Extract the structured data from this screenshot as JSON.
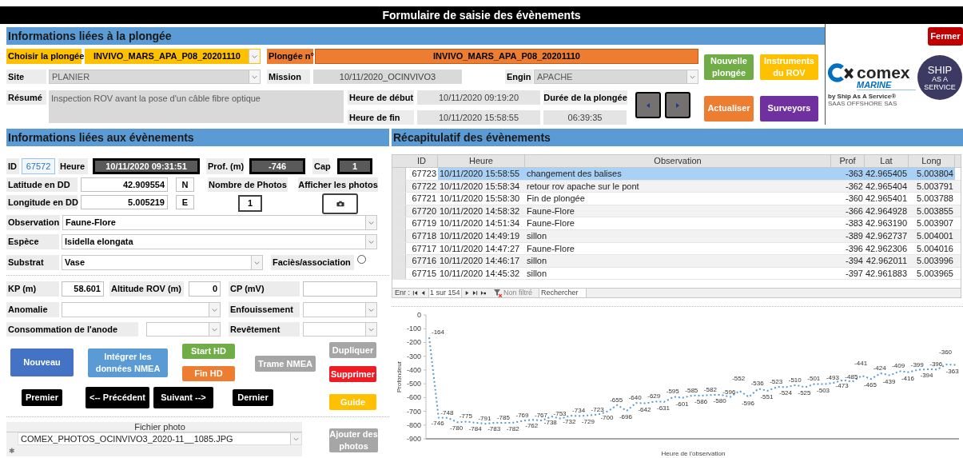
{
  "window": {
    "title": "Formulaire de saisie des évènements"
  },
  "close_button": {
    "label": "Fermer",
    "color": "#c00000"
  },
  "dive_section": {
    "heading": "Informations liées à la plongée",
    "choose_dive": {
      "label": "Choisir la plongée",
      "value": "INVIVO_MARS_APA_P08_20201110"
    },
    "dive_number": {
      "label": "Plongée n°",
      "value": "INVIVO_MARS_APA_P08_20201110"
    },
    "site": {
      "label": "Site",
      "value": "PLANIER"
    },
    "mission": {
      "label": "Mission",
      "value": "10/11/2020_OCINVIVO3"
    },
    "vehicle": {
      "label": "Engin",
      "value": "APACHE"
    },
    "summary": {
      "label": "Résumé",
      "value": "Inspection ROV avant la pose d'un câble fibre optique"
    },
    "start_time": {
      "label": "Heure de début",
      "value": "10/11/2020 09:19:20"
    },
    "end_time": {
      "label": "Heure de fin",
      "value": "10/11/2020 15:58:55"
    },
    "duration": {
      "label": "Durée de la plongée",
      "value": "06:39:35"
    },
    "buttons": [
      {
        "label": "Nouvelle plongée",
        "color": "#70ad47"
      },
      {
        "label": "Instruments du ROV",
        "color": "#ffc000"
      },
      {
        "label": "Actualiser",
        "color": "#ed7d31"
      },
      {
        "label": "Surveyors",
        "color": "#7030a0"
      }
    ]
  },
  "logo": {
    "brand": "comex",
    "division": "MARINE",
    "byline": "by Ship As A Service®",
    "company": "SAAS OFFSHORE SAS",
    "badge_lines": [
      "SHIP",
      "AS A",
      "SERVICE"
    ]
  },
  "event_section": {
    "heading": "Informations liées aux évènements",
    "id": {
      "label": "ID",
      "value": "67572"
    },
    "time": {
      "label": "Heure",
      "value": "10/11/2020 09:31:51"
    },
    "depth": {
      "label": "Prof. (m)",
      "value": "-746"
    },
    "bearing": {
      "label": "Cap",
      "value": "1"
    },
    "latitude": {
      "label": "Latitude en DD",
      "value": "42.909554",
      "hemisphere": "N"
    },
    "longitude": {
      "label": "Longitude en DD",
      "value": "5.005219",
      "hemisphere": "E"
    },
    "photo_count": {
      "label": "Nombre de Photos",
      "value": "1"
    },
    "show_photos": {
      "label": "Afficher les photos"
    },
    "observation": {
      "label": "Observation",
      "value": "Faune-Flore"
    },
    "species": {
      "label": "Espèce",
      "value": "Isidella elongata"
    },
    "substrate": {
      "label": "Substrat",
      "value": "Vase"
    },
    "facies": {
      "label": "Faciès/association",
      "checked": false
    },
    "kp": {
      "label": "KP (m)",
      "value": "58.601"
    },
    "rov_altitude": {
      "label": "Altitude ROV (m)",
      "value": "0"
    },
    "cp": {
      "label": "CP (mV)"
    },
    "anomaly": {
      "label": "Anomalie"
    },
    "burial": {
      "label": "Enfouissement"
    },
    "anode": {
      "label": "Consommation de l'anode"
    },
    "coating": {
      "label": "Revêtement"
    },
    "buttons": [
      {
        "label": "Nouveau",
        "color": "#4472c4"
      },
      {
        "label": "Intégrer les données NMEA",
        "color": "#5b9bd5"
      },
      {
        "label": "Start HD",
        "color": "#70ad47"
      },
      {
        "label": "Fin HD",
        "color": "#ed7d31"
      },
      {
        "label": "Trame NMEA",
        "color": "#a6a6a6"
      },
      {
        "label": "Dupliquer",
        "color": "#a6a6a6"
      },
      {
        "label": "Supprimer",
        "color": "#ee1c25"
      },
      {
        "label": "Premier",
        "color": "#000000"
      },
      {
        "label": "<-- Précédent",
        "color": "#000000"
      },
      {
        "label": "Suivant -->",
        "color": "#000000"
      },
      {
        "label": "Dernier",
        "color": "#000000"
      },
      {
        "label": "Guide",
        "color": "#ffc000"
      }
    ],
    "photos": {
      "column": "Fichier photo",
      "rows": [
        "COMEX_PHOTOS_OCINVIVO3_2020-11__1085.JPG"
      ],
      "new_record_marker": "✱",
      "add_button": "Ajouter des photos"
    }
  },
  "events_summary": {
    "heading": "Récapitulatif des évènements",
    "table": {
      "columns": [
        "ID",
        "Heure",
        "Observation",
        "Prof",
        "Lat",
        "Long"
      ],
      "rows": [
        {
          "cells": [
            "67723",
            "10/11/2020 15:58:55",
            "changement des balises",
            "-363",
            "42.965405",
            "5.003804"
          ],
          "selected": true
        },
        {
          "cells": [
            "67722",
            "10/11/2020 15:58:34",
            "retour rov apache sur le pont",
            "-362",
            "42.965404",
            "5.003791"
          ],
          "selected": false
        },
        {
          "cells": [
            "67721",
            "10/11/2020 15:58:30",
            "Fin de plongée",
            "-360",
            "42.965401",
            "5.003788"
          ],
          "selected": false
        },
        {
          "cells": [
            "67720",
            "10/11/2020 14:58:32",
            "Faune-Flore",
            "-366",
            "42.964928",
            "5.003855"
          ],
          "selected": false
        },
        {
          "cells": [
            "67719",
            "10/11/2020 14:51:34",
            "Faune-Flore",
            "-383",
            "42.963190",
            "5.003907"
          ],
          "selected": false
        },
        {
          "cells": [
            "67718",
            "10/11/2020 14:49:19",
            "sillon",
            "-389",
            "42.962737",
            "5.004001"
          ],
          "selected": false
        },
        {
          "cells": [
            "67717",
            "10/11/2020 14:47:27",
            "Faune-Flore",
            "-396",
            "42.962306",
            "5.004016"
          ],
          "selected": false
        },
        {
          "cells": [
            "67716",
            "10/11/2020 14:46:17",
            "sillon",
            "-394",
            "42.962011",
            "5.003996"
          ],
          "selected": false
        },
        {
          "cells": [
            "67715",
            "10/11/2020 14:45:32",
            "sillon",
            "-397",
            "42.961883",
            "5.003965"
          ],
          "selected": false
        }
      ]
    },
    "navigator": {
      "label": "Enr :",
      "position": "1 sur 154",
      "filter": "Non filtré",
      "search": "Rechercher"
    },
    "chart_data": {
      "type": "line",
      "xlabel": "Heure de l'observation",
      "ylabel": "Profondeur",
      "ylim": [
        -900,
        0
      ],
      "yticks": [
        0,
        -100,
        -200,
        -300,
        -400,
        -500,
        -600,
        -700,
        -800,
        -900
      ],
      "data_labels": true,
      "categories": [
        null,
        null,
        null,
        null,
        null,
        null,
        null,
        null,
        null,
        null,
        null,
        null,
        null,
        null,
        null,
        null,
        null,
        null,
        null,
        null,
        null,
        null,
        null,
        null,
        null,
        null,
        null,
        null,
        null,
        null,
        null,
        null,
        null,
        null,
        null,
        null,
        null,
        null,
        null,
        null,
        null,
        null,
        null,
        null,
        null,
        null,
        null,
        null,
        null,
        null,
        null,
        null,
        null,
        null,
        null,
        null,
        null
      ],
      "series": [
        {
          "color": "#5b9bd5",
          "line_style": "dotted",
          "values": [
            -164,
            -746,
            -748,
            -780,
            -775,
            -784,
            -791,
            -783,
            -785,
            -782,
            -769,
            -762,
            -767,
            -738,
            -753,
            -732,
            -734,
            -729,
            -723,
            -700,
            -655,
            -696,
            -640,
            -642,
            -629,
            -631,
            -595,
            -601,
            -585,
            -586,
            -582,
            -580,
            -596,
            -552,
            -596,
            -536,
            -551,
            -523,
            -524,
            -510,
            -525,
            -501,
            -503,
            -493,
            -473,
            -485,
            -441,
            -465,
            -424,
            -439,
            -409,
            -416,
            -399,
            -394,
            -396,
            -360,
            -363
          ]
        }
      ]
    }
  }
}
